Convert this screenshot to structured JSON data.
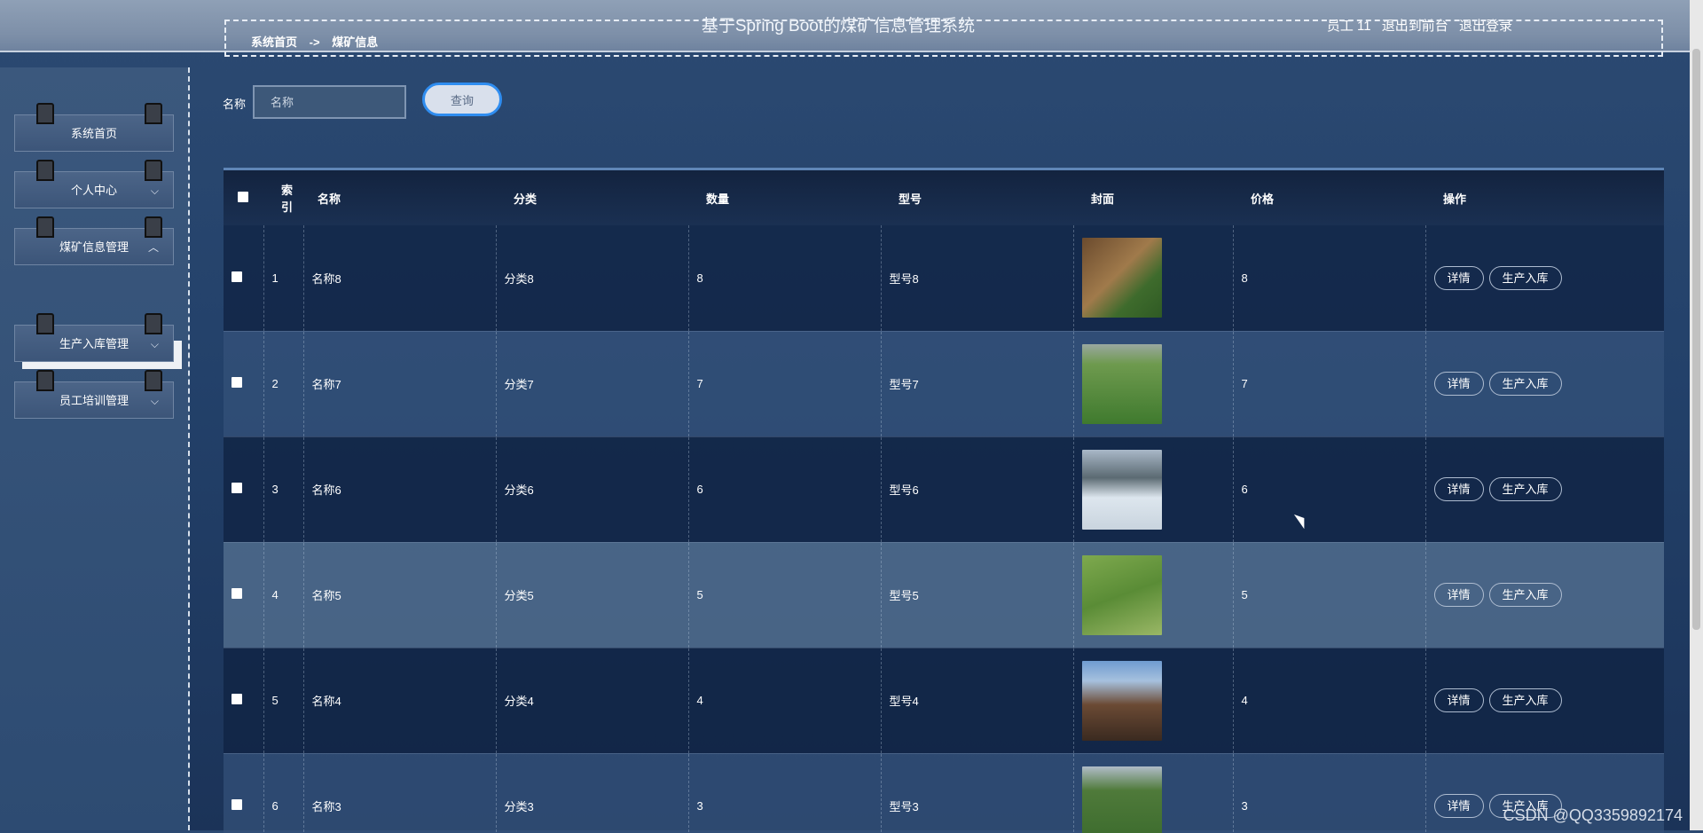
{
  "header": {
    "title": "基于Spring Boot的煤矿信息管理系统",
    "user": "员工 11",
    "to_front": "退出到前台",
    "logout": "退出登录",
    "breadcrumb": [
      "系统首页",
      "->",
      "煤矿信息"
    ]
  },
  "sidebar": {
    "items": [
      {
        "label": "系统首页"
      },
      {
        "label": "个人中心",
        "chevron": "chevron-down-icon"
      },
      {
        "label": "煤矿信息管理",
        "chevron": "chevron-up-icon"
      },
      {
        "label": "生产入库管理",
        "chevron": "chevron-down-icon"
      },
      {
        "label": "员工培训管理",
        "chevron": "chevron-down-icon"
      }
    ],
    "active_sub": "煤矿信息"
  },
  "search": {
    "label": "名称",
    "placeholder": "名称",
    "button": "查询"
  },
  "table": {
    "headers": [
      "索引",
      "名称",
      "分类",
      "数量",
      "型号",
      "封面",
      "价格",
      "操作"
    ],
    "actions": [
      "详情",
      "生产入库"
    ],
    "rows": [
      {
        "index": "1",
        "name": "名称8",
        "category": "分类8",
        "qty": "8",
        "model": "型号8",
        "price": "8"
      },
      {
        "index": "2",
        "name": "名称7",
        "category": "分类7",
        "qty": "7",
        "model": "型号7",
        "price": "7"
      },
      {
        "index": "3",
        "name": "名称6",
        "category": "分类6",
        "qty": "6",
        "model": "型号6",
        "price": "6"
      },
      {
        "index": "4",
        "name": "名称5",
        "category": "分类5",
        "qty": "5",
        "model": "型号5",
        "price": "5"
      },
      {
        "index": "5",
        "name": "名称4",
        "category": "分类4",
        "qty": "4",
        "model": "型号4",
        "price": "4"
      },
      {
        "index": "6",
        "name": "名称3",
        "category": "分类3",
        "qty": "3",
        "model": "型号3",
        "price": "3"
      }
    ]
  },
  "watermark": "CSDN @QQ3359892174"
}
